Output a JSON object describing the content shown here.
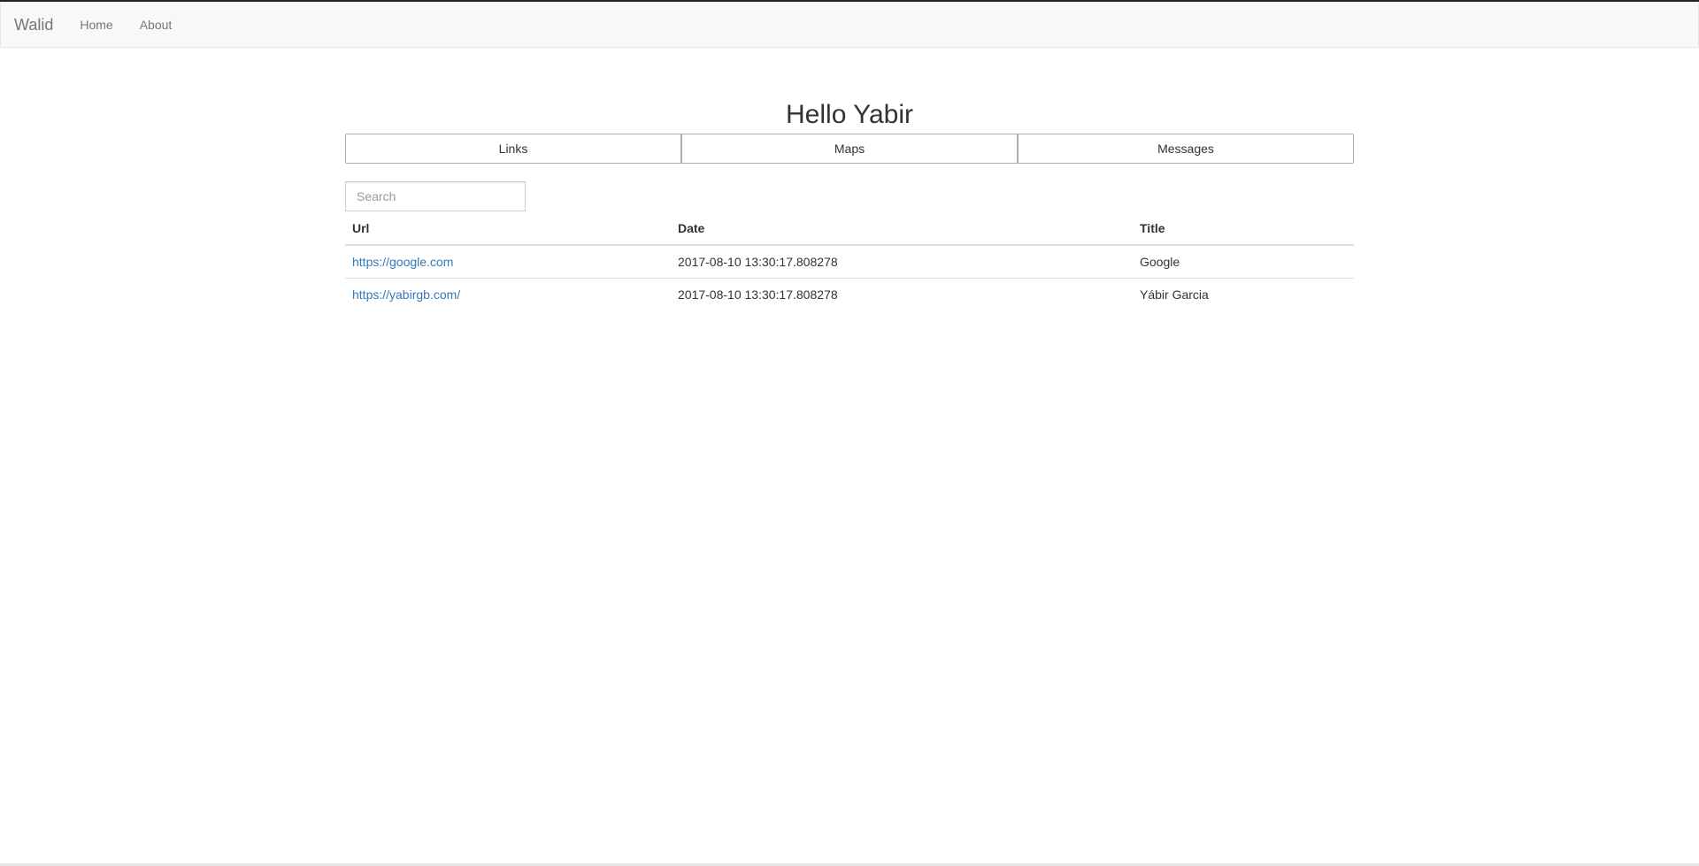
{
  "navbar": {
    "brand": "Walid",
    "links": [
      {
        "label": "Home"
      },
      {
        "label": "About"
      }
    ]
  },
  "page": {
    "title": "Hello Yabir"
  },
  "tabs": [
    {
      "label": "Links"
    },
    {
      "label": "Maps"
    },
    {
      "label": "Messages"
    }
  ],
  "search": {
    "placeholder": "Search",
    "value": ""
  },
  "table": {
    "headers": [
      "Url",
      "Date",
      "Title"
    ],
    "rows": [
      {
        "url": "https://google.com",
        "date": "2017-08-10 13:30:17.808278",
        "title": "Google"
      },
      {
        "url": "https://yabirgb.com/",
        "date": "2017-08-10 13:30:17.808278",
        "title": "Yábir Garcia"
      }
    ]
  },
  "colors": {
    "link": "#337ab7",
    "navbar_bg": "#f8f8f8",
    "nav_text": "#777777",
    "text": "#333333"
  }
}
